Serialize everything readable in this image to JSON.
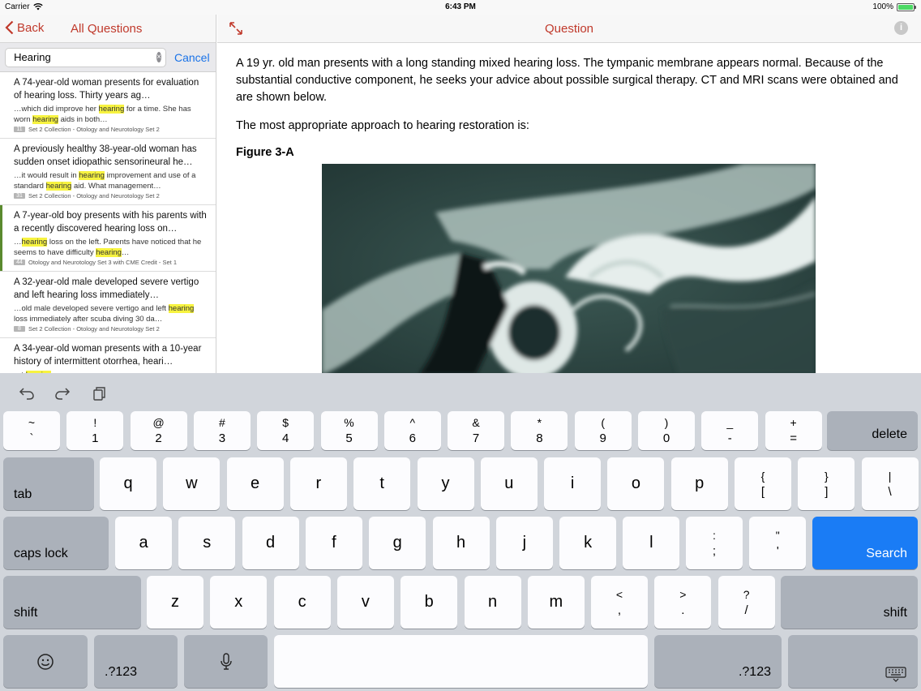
{
  "status_bar": {
    "carrier": "Carrier",
    "time": "6:43 PM",
    "battery": "100%"
  },
  "left_nav": {
    "back_label": "Back",
    "title": "All Questions"
  },
  "search": {
    "value": "Hearing",
    "cancel_label": "Cancel"
  },
  "results": [
    {
      "title": "A 74-year-old woman presents for evaluation of hearing loss. Thirty years ag…",
      "snippet_parts": [
        "…which did improve her ",
        "hearing",
        " for a time. She has worn ",
        "hearing",
        " aids in both…"
      ],
      "num": "11",
      "collection": "Set 2 Collection - Otology and Neurotology Set 2"
    },
    {
      "title": "A previously healthy 38-year-old woman has sudden onset idiopathic sensorineural he…",
      "snippet_parts": [
        "…it would result in ",
        "hearing",
        " improvement and use of a standard ",
        "hearing",
        " aid. What management…"
      ],
      "num": "31",
      "collection": "Set 2 Collection - Otology and Neurotology Set 2"
    },
    {
      "title": "A 7-year-old boy presents with his parents with a recently discovered hearing loss on…",
      "snippet_parts": [
        "…",
        "hearing",
        " loss on the left. Parents have noticed that he seems to have difficulty ",
        "hearing",
        "…"
      ],
      "num": "44",
      "collection": "Otology and Neurotology Set 3 with CME Credit - Set 1"
    },
    {
      "title": "A 32-year-old male developed severe vertigo and left hearing loss immediately…",
      "snippet_parts": [
        "…old male developed severe vertigo and left ",
        "hearing",
        " loss immediately after scuba diving 30 da…"
      ],
      "num": "8",
      "collection": "Set 2 Collection - Otology and Neurotology Set 2"
    },
    {
      "title": "A 34-year-old woman presents with a 10-year history of intermittent otorrhea, heari…",
      "snippet_parts": [
        "…t ",
        "hearing",
        " …"
      ],
      "num": "",
      "collection": ""
    }
  ],
  "right_nav": {
    "title": "Question",
    "info_label": "i"
  },
  "question": {
    "body": "A 19 yr. old man presents with a long standing mixed hearing loss. The tympanic membrane appears normal. Because of the substantial conductive component, he seeks your advice about possible surgical therapy. CT and MRI scans were obtained and are shown below.",
    "prompt": "The most appropriate approach to hearing restoration is:",
    "figure_label": "Figure 3-A"
  },
  "keyboard": {
    "row1": [
      {
        "top": "~",
        "bot": "`"
      },
      {
        "top": "!",
        "bot": "1"
      },
      {
        "top": "@",
        "bot": "2"
      },
      {
        "top": "#",
        "bot": "3"
      },
      {
        "top": "$",
        "bot": "4"
      },
      {
        "top": "%",
        "bot": "5"
      },
      {
        "top": "^",
        "bot": "6"
      },
      {
        "top": "&",
        "bot": "7"
      },
      {
        "top": "*",
        "bot": "8"
      },
      {
        "top": "(",
        "bot": "9"
      },
      {
        "top": ")",
        "bot": "0"
      },
      {
        "top": "_",
        "bot": "-"
      },
      {
        "top": "+",
        "bot": "="
      }
    ],
    "delete": "delete",
    "tab": "tab",
    "row2": [
      "q",
      "w",
      "e",
      "r",
      "t",
      "y",
      "u",
      "i",
      "o",
      "p"
    ],
    "row2_sym": [
      {
        "top": "{",
        "bot": "["
      },
      {
        "top": "}",
        "bot": "]"
      },
      {
        "top": "|",
        "bot": "\\"
      }
    ],
    "caps": "caps lock",
    "row3": [
      "a",
      "s",
      "d",
      "f",
      "g",
      "h",
      "j",
      "k",
      "l"
    ],
    "row3_sym": [
      {
        "top": ":",
        "bot": ";"
      },
      {
        "top": "\"",
        "bot": "'"
      }
    ],
    "search": "Search",
    "shift": "shift",
    "row4": [
      "z",
      "x",
      "c",
      "v",
      "b",
      "n",
      "m"
    ],
    "row4_sym": [
      {
        "top": "<",
        "bot": ","
      },
      {
        "top": ">",
        "bot": "."
      },
      {
        "top": "?",
        "bot": "/"
      }
    ],
    "num_label": ".?123",
    "icons": {
      "emoji": "emoji-icon",
      "mic": "microphone-icon",
      "dismiss": "keyboard-dismiss-icon",
      "undo": "undo-icon",
      "redo": "redo-icon",
      "paste": "paste-icon"
    }
  },
  "colors": {
    "accent": "#c0392b",
    "link": "#1a73e8",
    "highlight": "#f7f340",
    "search_key": "#1a7cf5",
    "selected_bar": "#5a8a2e"
  }
}
